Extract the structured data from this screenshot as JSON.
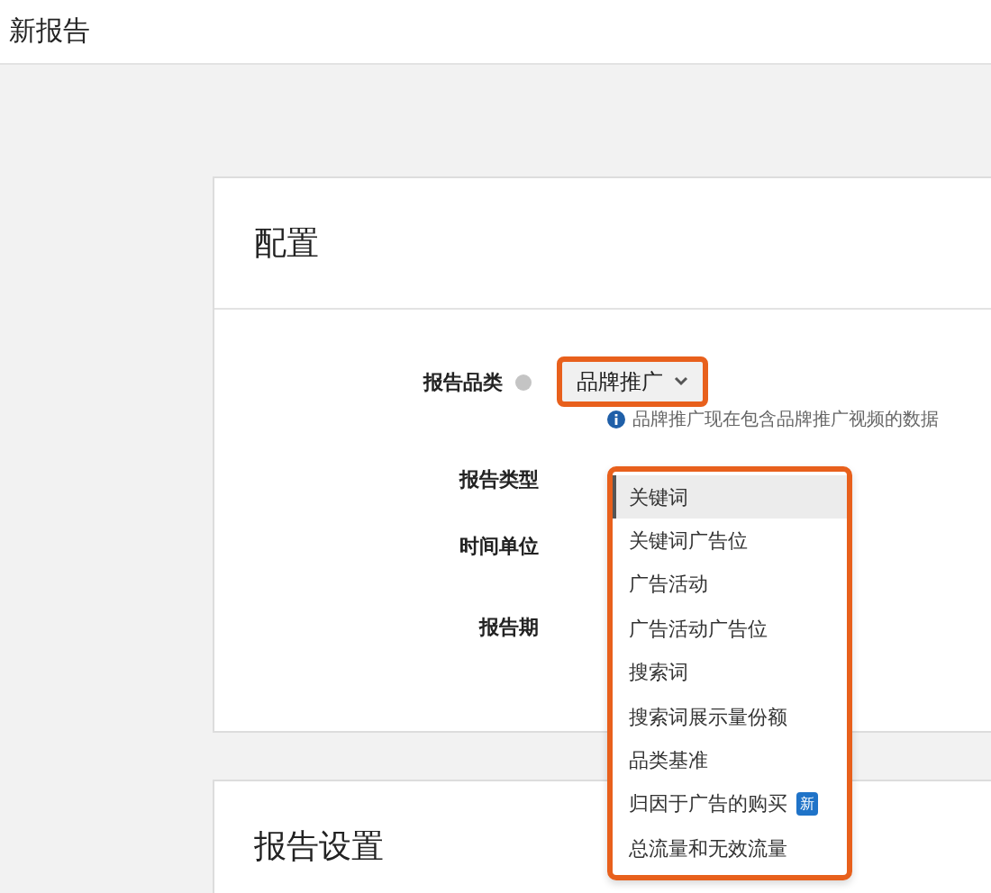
{
  "page": {
    "title": "新报告"
  },
  "config_card": {
    "title": "配置",
    "category": {
      "label": "报告品类",
      "value": "品牌推广",
      "highlighted": true,
      "hint": "品牌推广现在包含品牌推广视频的数据"
    },
    "labels": [
      "报告类型",
      "时间单位",
      "报告期"
    ],
    "report_type_menu": {
      "highlighted": true,
      "items": [
        {
          "label": "关键词",
          "selected": true
        },
        {
          "label": "关键词广告位",
          "selected": false
        },
        {
          "label": "广告活动",
          "selected": false
        },
        {
          "label": "广告活动广告位",
          "selected": false
        },
        {
          "label": "搜索词",
          "selected": false
        },
        {
          "label": "搜索词展示量份额",
          "selected": false
        },
        {
          "label": "品类基准",
          "selected": false
        },
        {
          "label": "归因于广告的购买",
          "selected": false,
          "badge": "新"
        },
        {
          "label": "总流量和无效流量",
          "selected": false
        }
      ]
    }
  },
  "settings_card": {
    "title": "报告设置"
  }
}
